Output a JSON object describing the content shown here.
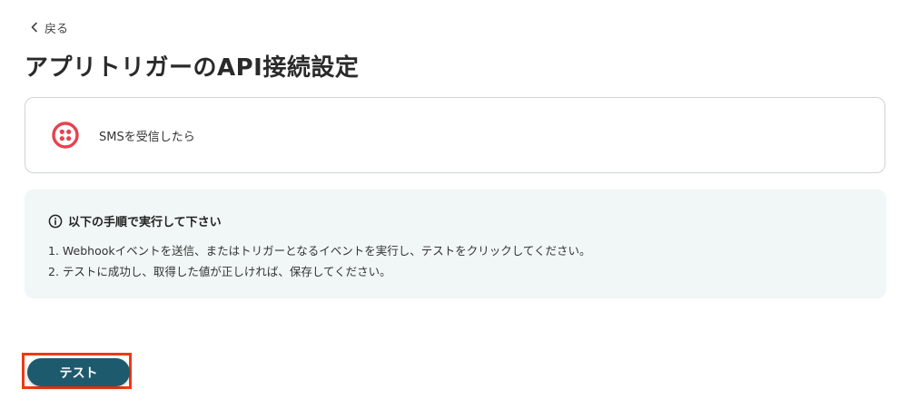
{
  "nav": {
    "back_label": "戻る"
  },
  "page": {
    "title": "アプリトリガーのAPI接続設定"
  },
  "trigger": {
    "app_icon": "twilio-logo",
    "label": "SMSを受信したら",
    "icon_color": "#e8414f"
  },
  "instructions": {
    "heading": "以下の手順で実行して下さい",
    "steps": [
      "1. Webhookイベントを送信、またはトリガーとなるイベントを実行し、テストをクリックしてください。",
      "2. テストに成功し、取得した値が正しければ、保存してください。"
    ],
    "background": "#f1f7f6"
  },
  "actions": {
    "test_label": "テスト",
    "test_color": "#1e5a6e",
    "highlight_color": "#ee3a13"
  }
}
